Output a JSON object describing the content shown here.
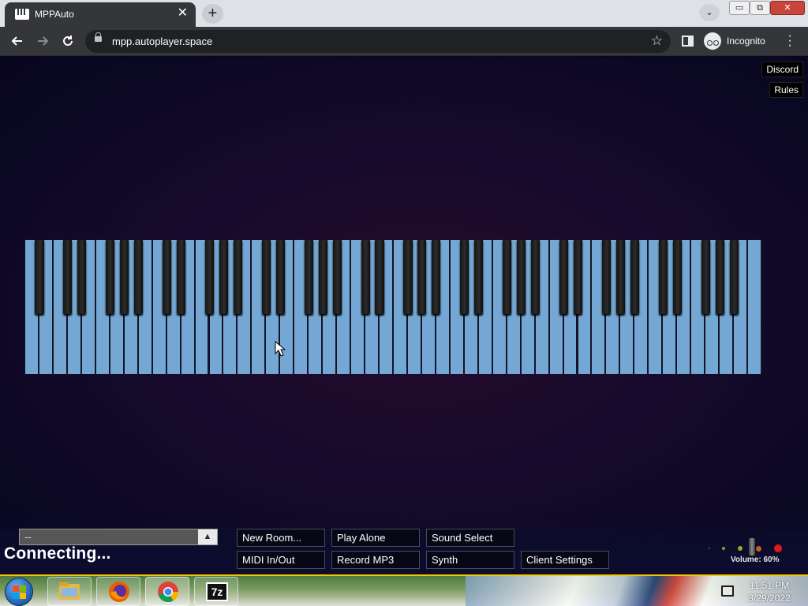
{
  "browser": {
    "tab_title": "MPPAuto",
    "tab_close": "✕",
    "new_tab": "+",
    "tab_search": "⌄",
    "url": "mpp.autoplayer.space",
    "incognito_label": "Incognito",
    "window_controls": {
      "minimize": "▭",
      "maximize": "⧉",
      "close": "✕"
    }
  },
  "page": {
    "discord_label": "Discord",
    "rules_label": "Rules",
    "piano": {
      "white_keys": 52,
      "key_color": "#74a7d3",
      "black_key_color": "#1f1f1f"
    },
    "room_select": {
      "value": "--",
      "arrow": "▲"
    },
    "status": "Connecting...",
    "buttons": {
      "new_room": "New Room...",
      "play_alone": "Play Alone",
      "sound_select": "Sound Select",
      "midi": "MIDI In/Out",
      "record": "Record MP3",
      "synth": "Synth",
      "client_settings": "Client Settings"
    },
    "volume_label": "Volume: 60%",
    "volume": 0.6
  },
  "taskbar": {
    "time": "11:51 PM",
    "date": "3/29/2022",
    "apps": [
      "explorer",
      "firefox",
      "chrome",
      "7-zip"
    ],
    "seven_zip_label": "7z"
  }
}
